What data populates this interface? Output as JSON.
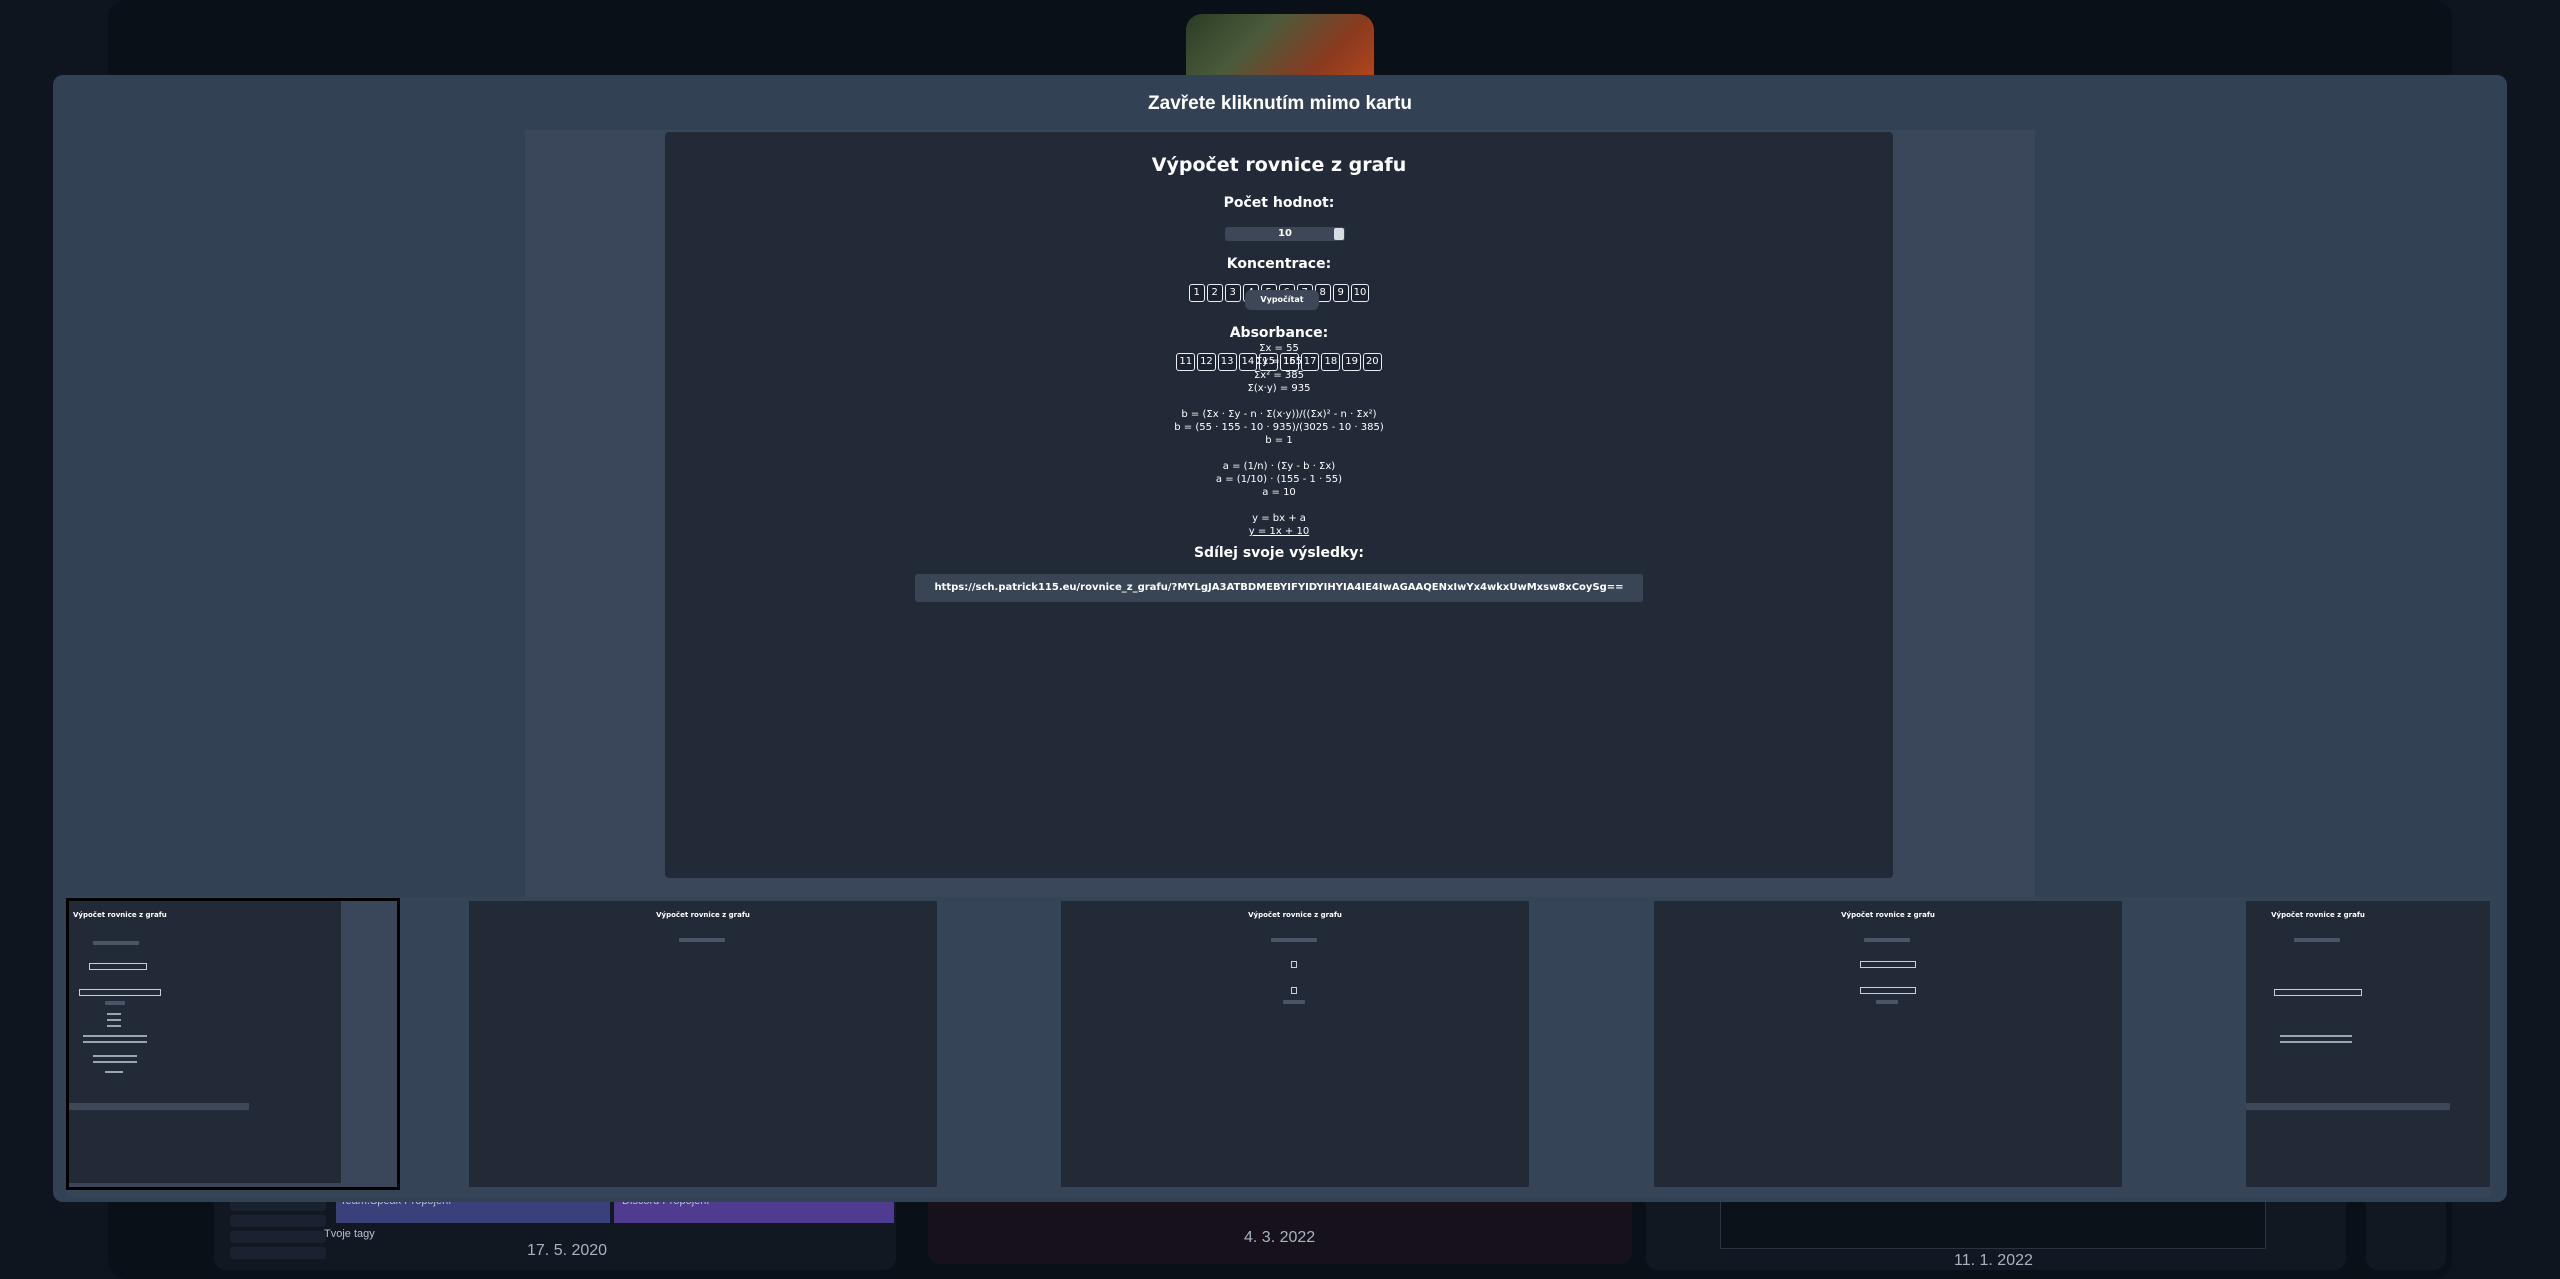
{
  "background": {
    "cards": [
      {
        "date": "17. 5. 2020",
        "buttons": [
          "Team.Speak Propojení",
          "Discord Propojení"
        ],
        "caption": "Tvoje tagy"
      },
      {
        "date": "4. 3. 2022"
      },
      {
        "date": "11. 1. 2022"
      }
    ]
  },
  "lightbox": {
    "close_hint": "Zavřete kliknutím mimo kartu"
  },
  "app": {
    "title": "Výpočet rovnice z grafu",
    "count_label": "Počet hodnot:",
    "count_value": "10",
    "concentration_label": "Koncentrace:",
    "concentrations": [
      "1",
      "2",
      "3",
      "4",
      "5",
      "6",
      "7",
      "8",
      "9",
      "10"
    ],
    "absorbance_label": "Absorbance:",
    "absorbances": [
      "11",
      "12",
      "13",
      "14",
      "15",
      "16",
      "17",
      "18",
      "19",
      "20"
    ],
    "calculate_button": "Vypočítat",
    "sums": [
      "Σx = 55",
      "Σy = 155",
      "Σx² = 385",
      "Σ(x·y) = 935"
    ],
    "b_steps": [
      "b = (Σx · Σy - n · Σ(x·y))/((Σx)² - n · Σx²)",
      "b = (55 · 155 - 10 · 935)/(3025 - 10 · 385)",
      "b = 1"
    ],
    "a_steps": [
      "a = (1/n) · (Σy - b · Σx)",
      "a = (1/10) · (155 - 1 · 55)",
      "a = 10"
    ],
    "equation_general": "y = bx + a",
    "equation_result": "y = 1x + 10",
    "share_label": "Sdílej svoje výsledky:",
    "share_url": "https://sch.patrick115.eu/rovnice_z_grafu/?MYLgJA3ATBDMEBYIFYIDYIHYIA4IE4IwAGAAQENxIwYx4wkxUwMxsw8xCoySg=="
  },
  "thumbnails": [
    {
      "title": "Výpočet rovnice z grafu",
      "state": "result",
      "active": true
    },
    {
      "title": "Výpočet rovnice z grafu",
      "state": "empty",
      "active": false
    },
    {
      "title": "Výpočet rovnice z grafu",
      "state": "single",
      "active": false
    },
    {
      "title": "Výpočet rovnice z grafu",
      "state": "inputs",
      "active": false
    },
    {
      "title": "Výpočet rovnice z grafu",
      "state": "result",
      "active": false
    }
  ]
}
